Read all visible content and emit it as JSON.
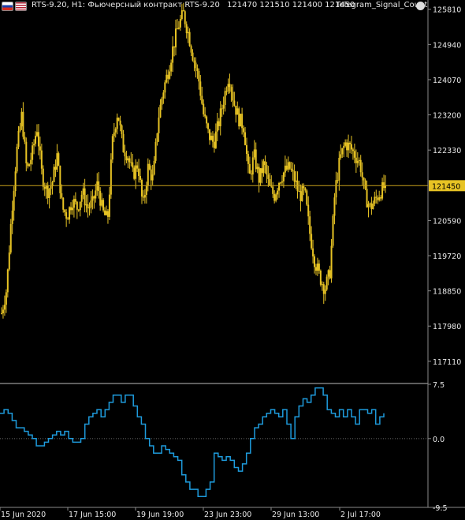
{
  "header": {
    "title": "RTS-9.20, H1:  Фьючерсный контракт RTS-9.20",
    "ohlc": "121470 121510 121400 121450",
    "indicator_name": "Telegram_Signal_Count"
  },
  "colors": {
    "background": "#000000",
    "candles": "#e7c324",
    "price_line": "#c8a21c",
    "price_label_bg": "#e7c324",
    "indicator": "#1e9bdc",
    "axis": "#8a8a8a"
  },
  "chart_data": [
    {
      "type": "candlestick",
      "title": "RTS-9.20, H1",
      "current_price": 121450,
      "current_price_label": "121450",
      "ylim": [
        116600,
        126000
      ],
      "yticks": [
        125810,
        124940,
        124070,
        123200,
        122330,
        120590,
        119720,
        118850,
        117980,
        117110
      ],
      "ytick_labels": [
        "125810",
        "124940",
        "124070",
        "123200",
        "122330",
        "120590",
        "119720",
        "118850",
        "117980",
        "117110"
      ],
      "xtick_labels": [
        "15 Jun 2020",
        "17 Jun 15:00",
        "19 Jun 19:00",
        "23 Jun 23:00",
        "29 Jun 13:00",
        "2 Jul 17:00"
      ],
      "close_path": [
        118300,
        118900,
        120800,
        122300,
        123200,
        121800,
        122200,
        122900,
        121700,
        121300,
        121500,
        122200,
        120900,
        120700,
        121100,
        120900,
        121300,
        120900,
        121000,
        121500,
        120800,
        120600,
        122600,
        123300,
        122400,
        122200,
        121700,
        122000,
        120900,
        121900,
        121600,
        123100,
        123800,
        124300,
        124900,
        125400,
        125700,
        125200,
        124600,
        124100,
        123200,
        122700,
        122500,
        123000,
        123600,
        124200,
        123500,
        123100,
        122900,
        121600,
        122200,
        121600,
        122000,
        121400,
        121200,
        121600,
        121800,
        121900,
        121600,
        121200,
        121300,
        120300,
        119600,
        119200,
        118900,
        119300,
        121300,
        122100,
        122500,
        122400,
        122200,
        122000,
        121200,
        120900,
        121100,
        121300,
        121450
      ]
    },
    {
      "type": "line",
      "title": "Telegram_Signal_Count",
      "ylim": [
        -9.5,
        7.5
      ],
      "yticks": [
        7.5,
        0.0,
        -9.5
      ],
      "ytick_labels": [
        "7.5",
        "0.0",
        "-9.5"
      ],
      "values": [
        3.5,
        4,
        3.5,
        2.5,
        1.5,
        1.5,
        1,
        0.5,
        0,
        -1,
        -1,
        -0.5,
        0,
        0.5,
        1,
        0.5,
        1,
        0,
        -0.5,
        -0.5,
        0,
        2,
        3,
        3.5,
        4,
        3,
        4,
        5,
        6,
        6,
        5,
        6,
        6,
        4.5,
        3,
        2,
        0,
        -1,
        -2,
        -2,
        -1,
        -1.5,
        -2,
        -2.5,
        -3,
        -5,
        -6,
        -7,
        -7,
        -8,
        -8,
        -7,
        -6,
        -2,
        -2.5,
        -3,
        -2.5,
        -3,
        -4,
        -4.5,
        -3.5,
        -2,
        0,
        1.5,
        2,
        3,
        3.5,
        4,
        3.5,
        3,
        4,
        2,
        0,
        3,
        4.5,
        5.5,
        5,
        6,
        7,
        7,
        6,
        4,
        3.5,
        3,
        4,
        3,
        4,
        3,
        2,
        4,
        4,
        3.5,
        4,
        2,
        3,
        3.5
      ]
    }
  ]
}
